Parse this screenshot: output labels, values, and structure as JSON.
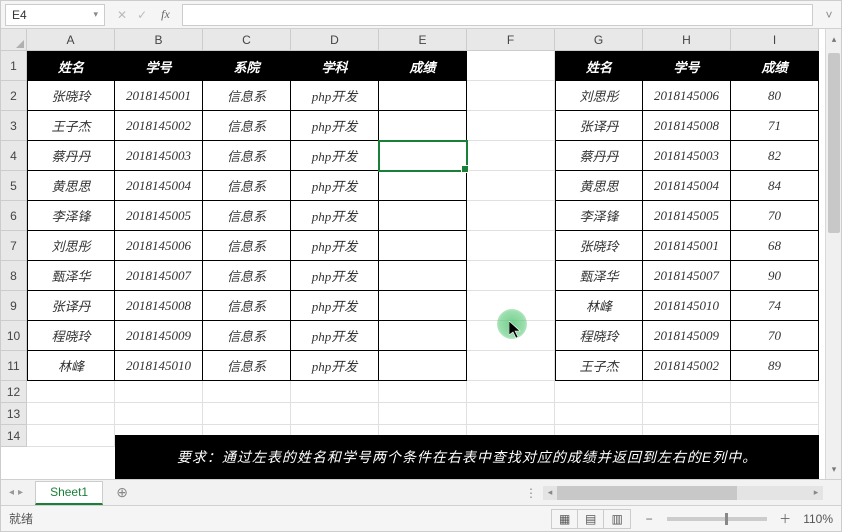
{
  "name_box": {
    "value": "E4",
    "dropdown_glyph": "▾"
  },
  "formula_bar": {
    "cancel_glyph": "✕",
    "confirm_glyph": "✓",
    "fx_label": "fx",
    "value": "",
    "expand_glyph": "˅"
  },
  "columns": [
    "A",
    "B",
    "C",
    "D",
    "E",
    "F",
    "G",
    "H",
    "I"
  ],
  "rows": [
    "1",
    "2",
    "3",
    "4",
    "5",
    "6",
    "7",
    "8",
    "9",
    "10",
    "11",
    "12",
    "13",
    "14"
  ],
  "left_table": {
    "headers": [
      "姓名",
      "学号",
      "系院",
      "学科",
      "成绩"
    ],
    "rows": [
      [
        "张晓玲",
        "2018145001",
        "信息系",
        "php开发",
        ""
      ],
      [
        "王子杰",
        "2018145002",
        "信息系",
        "php开发",
        ""
      ],
      [
        "蔡丹丹",
        "2018145003",
        "信息系",
        "php开发",
        ""
      ],
      [
        "黄思思",
        "2018145004",
        "信息系",
        "php开发",
        ""
      ],
      [
        "李泽锋",
        "2018145005",
        "信息系",
        "php开发",
        ""
      ],
      [
        "刘思彤",
        "2018145006",
        "信息系",
        "php开发",
        ""
      ],
      [
        "甄泽华",
        "2018145007",
        "信息系",
        "php开发",
        ""
      ],
      [
        "张译丹",
        "2018145008",
        "信息系",
        "php开发",
        ""
      ],
      [
        "程晓玲",
        "2018145009",
        "信息系",
        "php开发",
        ""
      ],
      [
        "林峰",
        "2018145010",
        "信息系",
        "php开发",
        ""
      ]
    ]
  },
  "right_table": {
    "headers": [
      "姓名",
      "学号",
      "成绩"
    ],
    "rows": [
      [
        "刘思彤",
        "2018145006",
        "80"
      ],
      [
        "张译丹",
        "2018145008",
        "71"
      ],
      [
        "蔡丹丹",
        "2018145003",
        "82"
      ],
      [
        "黄思思",
        "2018145004",
        "84"
      ],
      [
        "李泽锋",
        "2018145005",
        "70"
      ],
      [
        "张晓玲",
        "2018145001",
        "68"
      ],
      [
        "甄泽华",
        "2018145007",
        "90"
      ],
      [
        "林峰",
        "2018145010",
        "74"
      ],
      [
        "程晓玲",
        "2018145009",
        "70"
      ],
      [
        "王子杰",
        "2018145002",
        "89"
      ]
    ]
  },
  "instruction": "要求：通过左表的姓名和学号两个条件在右表中查找对应的成绩并返回到左右的E列中。",
  "active_cell": "E4",
  "sheetbar": {
    "nav_glyphs": [
      "◂",
      "▸"
    ],
    "tab_label": "Sheet1",
    "add_glyph": "⊕",
    "dots": "⋮",
    "hscroll_left": "◂",
    "hscroll_right": "▸"
  },
  "statusbar": {
    "ready": "就绪",
    "view_icons": [
      "▦",
      "▤",
      "▥"
    ],
    "zoom_minus": "−",
    "zoom_plus": "＋",
    "zoom_value": "110%"
  }
}
